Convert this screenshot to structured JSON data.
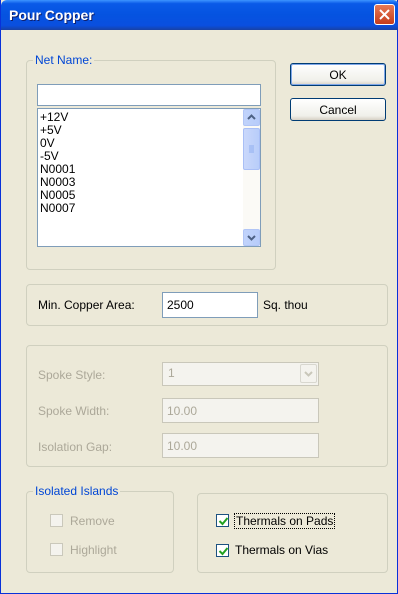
{
  "window": {
    "title": "Pour Copper"
  },
  "net_name": {
    "legend": "Net Name:",
    "value": "",
    "items": [
      "+12V",
      "+5V",
      "0V",
      "-5V",
      "N0001",
      "N0003",
      "N0005",
      "N0007"
    ]
  },
  "buttons": {
    "ok": "OK",
    "cancel": "Cancel"
  },
  "min_copper": {
    "label": "Min. Copper Area:",
    "value": "2500",
    "unit": "Sq. thou"
  },
  "spoke": {
    "style_label": "Spoke Style:",
    "style_value": "1",
    "width_label": "Spoke Width:",
    "width_value": "10.00",
    "gap_label": "Isolation Gap:",
    "gap_value": "10.00"
  },
  "isolated_islands": {
    "legend": "Isolated Islands",
    "remove_label": "Remove",
    "remove_checked": false,
    "highlight_label": "Highlight",
    "highlight_checked": false
  },
  "thermals": {
    "pads_label": "Thermals on Pads",
    "pads_checked": true,
    "vias_label": "Thermals on Vias",
    "vias_checked": true
  },
  "colors": {
    "title_bar": "#0553e0",
    "dialog_bg": "#ece9d8",
    "group_label": "#0046d5",
    "check_mark": "#21a121",
    "close_button": "#c53c1b"
  }
}
